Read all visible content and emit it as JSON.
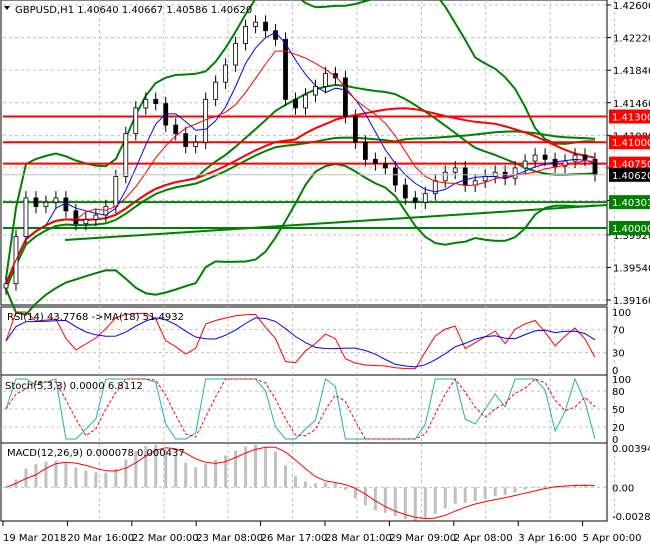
{
  "header": {
    "symbol": "GBPUSD,H1",
    "open": "1.40640",
    "high": "1.40667",
    "low": "1.40586",
    "close": "1.40620"
  },
  "chart_data": {
    "type": "candlestick",
    "ylim": [
      1.3916,
      1.426
    ],
    "price_ticks": [
      "1.42600",
      "1.42220",
      "1.41840",
      "1.41460",
      "1.41080",
      "1.40700",
      "1.40320",
      "1.39920",
      "1.39540",
      "1.39160"
    ],
    "x_labels": [
      "19 Mar 2018",
      "20 Mar 16:00",
      "22 Mar 00:00",
      "23 Mar 08:00",
      "26 Mar 17:00",
      "28 Mar 01:00",
      "29 Mar 09:00",
      "2 Apr 08:00",
      "3 Apr 16:00",
      "5 Apr 00:00"
    ],
    "closes": [
      1.3935,
      1.399,
      1.4035,
      1.4025,
      1.403,
      1.4035,
      1.402,
      1.4005,
      1.401,
      1.4015,
      1.4025,
      1.406,
      1.411,
      1.414,
      1.415,
      1.4145,
      1.412,
      1.411,
      1.4095,
      1.41,
      1.415,
      1.417,
      1.419,
      1.4215,
      1.4235,
      1.424,
      1.423,
      1.422,
      1.415,
      1.414,
      1.4155,
      1.4165,
      1.418,
      1.4175,
      1.413,
      1.41,
      1.408,
      1.4075,
      1.407,
      1.405,
      1.4035,
      1.403,
      1.404,
      1.4055,
      1.4065,
      1.407,
      1.405,
      1.4055,
      1.406,
      1.4065,
      1.4058,
      1.407,
      1.4078,
      1.4085,
      1.408,
      1.4072,
      1.4078,
      1.4085,
      1.408,
      1.4062
    ],
    "levels": [
      {
        "price": 1.413,
        "label": "1.41300",
        "color": "#ff0000"
      },
      {
        "price": 1.41,
        "label": "1.41000",
        "color": "#ff0000"
      },
      {
        "price": 1.4075,
        "label": "1.40750",
        "color": "#ff0000"
      },
      {
        "price": 1.40301,
        "label": "1.40301",
        "color": "#008000"
      },
      {
        "price": 1.4,
        "label": "1.40000",
        "color": "#008000"
      }
    ],
    "current_price": {
      "price": 1.4062,
      "label": "1.40620"
    },
    "rsi": {
      "label": "RSI(14) 43.7768  ->MA(18) 51.4932",
      "ticks": [
        "100",
        "70",
        "30",
        "0"
      ]
    },
    "stoch": {
      "label": "Stoch(5,3,3) 0.0000 6.8112",
      "ticks": [
        "100",
        "80",
        "50",
        "20",
        "0"
      ]
    },
    "macd": {
      "label": "MACD(12,26,9) 0.000078 0.000437",
      "ticks": [
        "0.003943",
        "0.00",
        "-0.002875"
      ],
      "ylim": [
        -0.002875,
        0.003943
      ]
    }
  }
}
